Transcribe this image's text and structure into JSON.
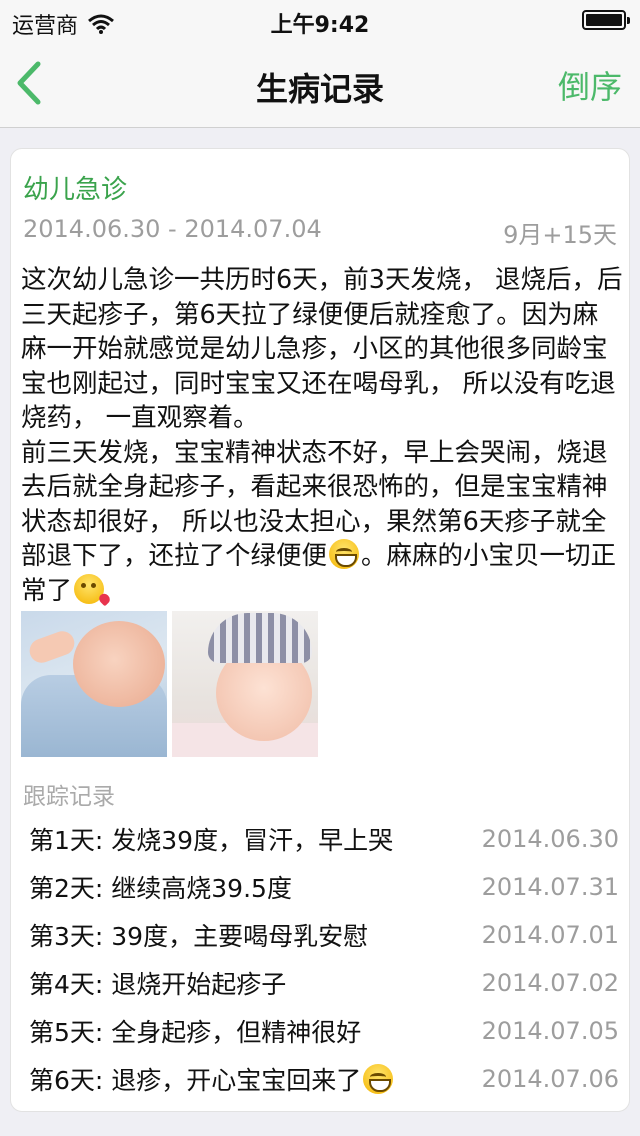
{
  "status_bar": {
    "carrier": "运营商",
    "time": "上午9:42",
    "battery_level": 1.0
  },
  "nav": {
    "title": "生病记录",
    "right_label": "倒序",
    "accent_color": "#4cb96a"
  },
  "record": {
    "title": "幼儿急诊",
    "dates": "2014.06.30 - 2014.07.04",
    "age": "9月+15天",
    "body_paragraph_1": "这次幼儿急诊一共历时6天，前3天发烧， 退烧后，后三天起疹子，第6天拉了绿便便后就痊愈了。因为麻麻一开始就感觉是幼儿急疹，小区的其他很多同龄宝宝也刚起过，同时宝宝又还在喝母乳， 所以没有吃退烧药， 一直观察着。",
    "body_paragraph_2_a": "前三天发烧，宝宝精神状态不好，早上会哭闹，烧退去后就全身起疹子，看起来很恐怖的，但是宝宝精神状态却很好， 所以也没太担心，果然第6天疹子就全部退下了，还拉了个绿便便",
    "body_paragraph_2_b": "。麻麻的小宝贝一切正常了",
    "emoji_1": "grinning-face",
    "emoji_2": "face-blowing-kiss",
    "photos": [
      "crying-baby-photo",
      "smiling-baby-photo"
    ]
  },
  "tracking": {
    "label": "跟踪记录",
    "entries": [
      {
        "text": "第1天: 发烧39度，冒汗，早上哭",
        "date": "2014.06.30"
      },
      {
        "text": "第2天: 继续高烧39.5度",
        "date": "2014.07.31"
      },
      {
        "text": "第3天: 39度，主要喝母乳安慰",
        "date": "2014.07.01"
      },
      {
        "text": "第4天: 退烧开始起疹子",
        "date": "2014.07.02"
      },
      {
        "text": "第5天: 全身起疹，但精神很好",
        "date": "2014.07.05"
      },
      {
        "text": "第6天: 退疹，开心宝宝回来了",
        "date": "2014.07.06",
        "emoji": "grinning-face"
      }
    ]
  }
}
